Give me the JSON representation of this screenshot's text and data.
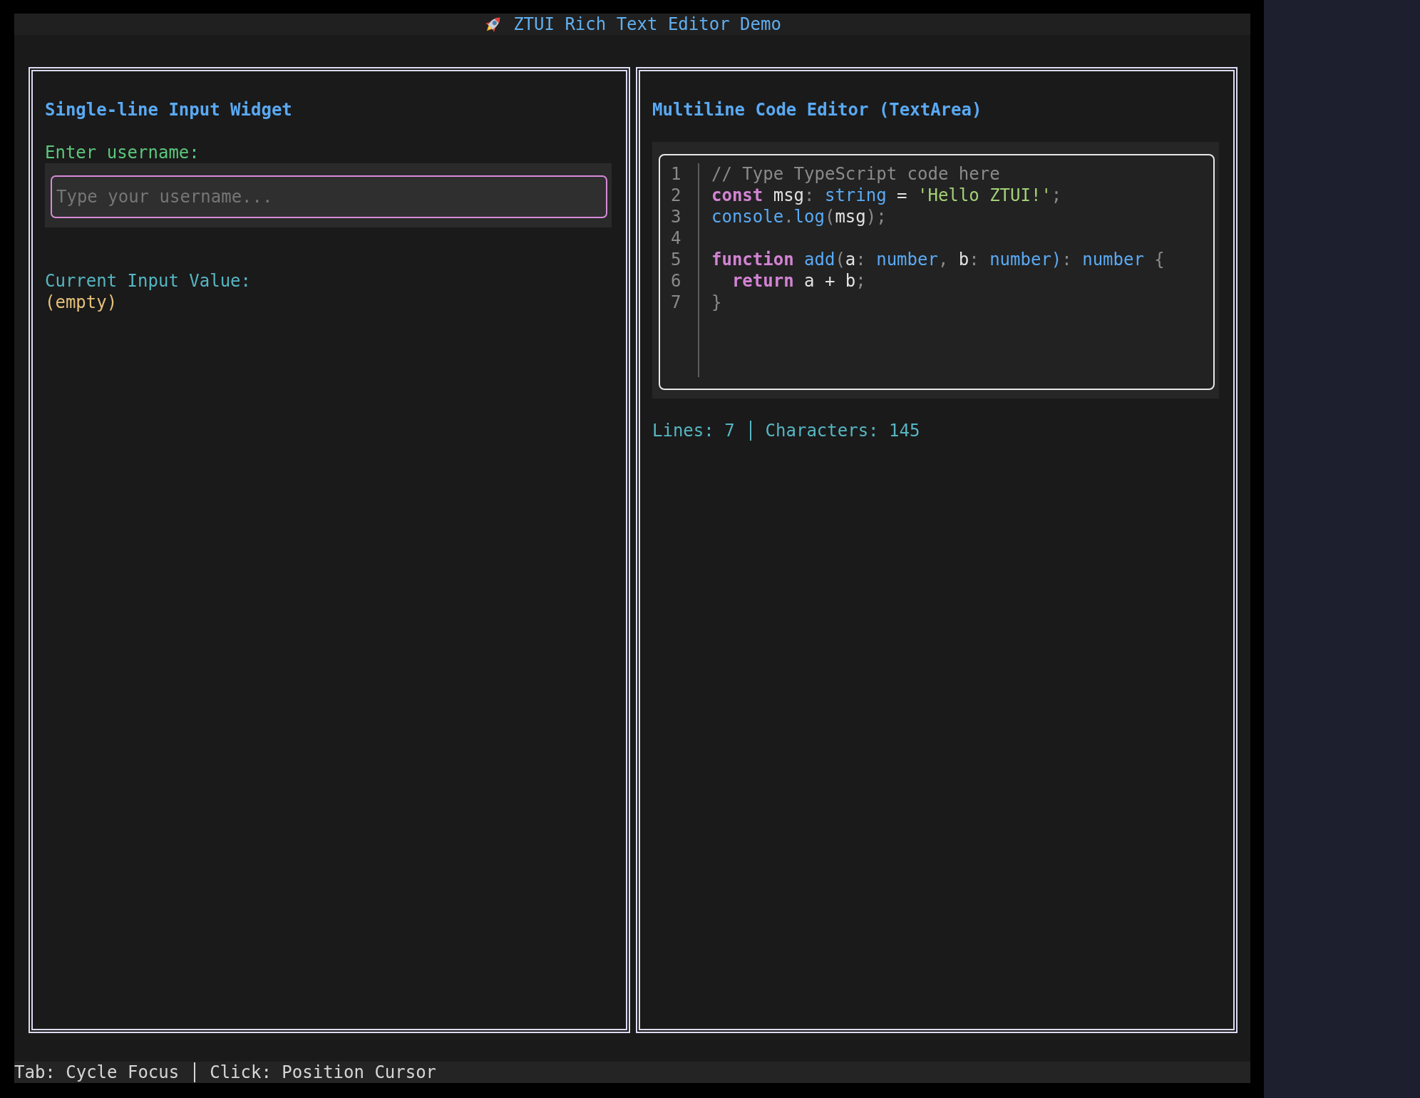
{
  "window": {
    "title": "ZTUI Rich Text Editor Demo"
  },
  "panels": [
    {
      "kind": "input",
      "title": "Single-line Input Widget",
      "field_label": "Enter username:",
      "field": {
        "placeholder": "Type your username...",
        "focused": true
      },
      "value_label": "Current Input Value:",
      "value_text": "(empty)"
    },
    {
      "kind": "code",
      "title": "Multiline Code Editor (TextArea)",
      "editor": {
        "lines": [
          {
            "number": "1",
            "tokens": [
              {
                "kind": "comment",
                "text": "// Type TypeScript code here"
              }
            ]
          },
          {
            "number": "2",
            "tokens": [
              {
                "kind": "keyword",
                "text": "const"
              },
              {
                "kind": "plain",
                "text": " msg"
              },
              {
                "kind": "punct",
                "text": ":"
              },
              {
                "kind": "type",
                "text": " string"
              },
              {
                "kind": "plain",
                "text": " ="
              },
              {
                "kind": "string",
                "text": " 'Hello ZTUI!'"
              },
              {
                "kind": "punct",
                "text": ";"
              }
            ]
          },
          {
            "number": "3",
            "tokens": [
              {
                "kind": "func",
                "text": "console"
              },
              {
                "kind": "punct",
                "text": "."
              },
              {
                "kind": "func",
                "text": "log"
              },
              {
                "kind": "punct",
                "text": "("
              },
              {
                "kind": "plain",
                "text": "msg"
              },
              {
                "kind": "punct",
                "text": ");"
              }
            ]
          },
          {
            "number": "4"
          },
          {
            "number": "5",
            "tokens": [
              {
                "kind": "keyword",
                "text": "function"
              },
              {
                "kind": "func",
                "text": " add"
              },
              {
                "kind": "punct",
                "text": "("
              },
              {
                "kind": "plain",
                "text": "a"
              },
              {
                "kind": "punct",
                "text": ":"
              },
              {
                "kind": "type",
                "text": " number"
              },
              {
                "kind": "punct",
                "text": ","
              },
              {
                "kind": "plain",
                "text": " b"
              },
              {
                "kind": "punct",
                "text": ":"
              },
              {
                "kind": "type",
                "text": " number)"
              },
              {
                "kind": "punct",
                "text": ":"
              },
              {
                "kind": "type",
                "text": " number"
              },
              {
                "kind": "punct",
                "text": " {"
              }
            ]
          },
          {
            "number": "6",
            "tokens": [
              {
                "kind": "keyword",
                "text": "  return"
              },
              {
                "kind": "plain",
                "text": " a + b"
              },
              {
                "kind": "punct",
                "text": ";"
              }
            ]
          },
          {
            "number": "7",
            "tokens": [
              {
                "kind": "punct",
                "text": "}"
              }
            ]
          }
        ]
      },
      "stats": [
        "Lines: 7",
        "Characters: 145"
      ]
    }
  ],
  "status_bar": {
    "hints": [
      "Tab: Cycle Focus",
      "Click: Position Cursor"
    ]
  }
}
